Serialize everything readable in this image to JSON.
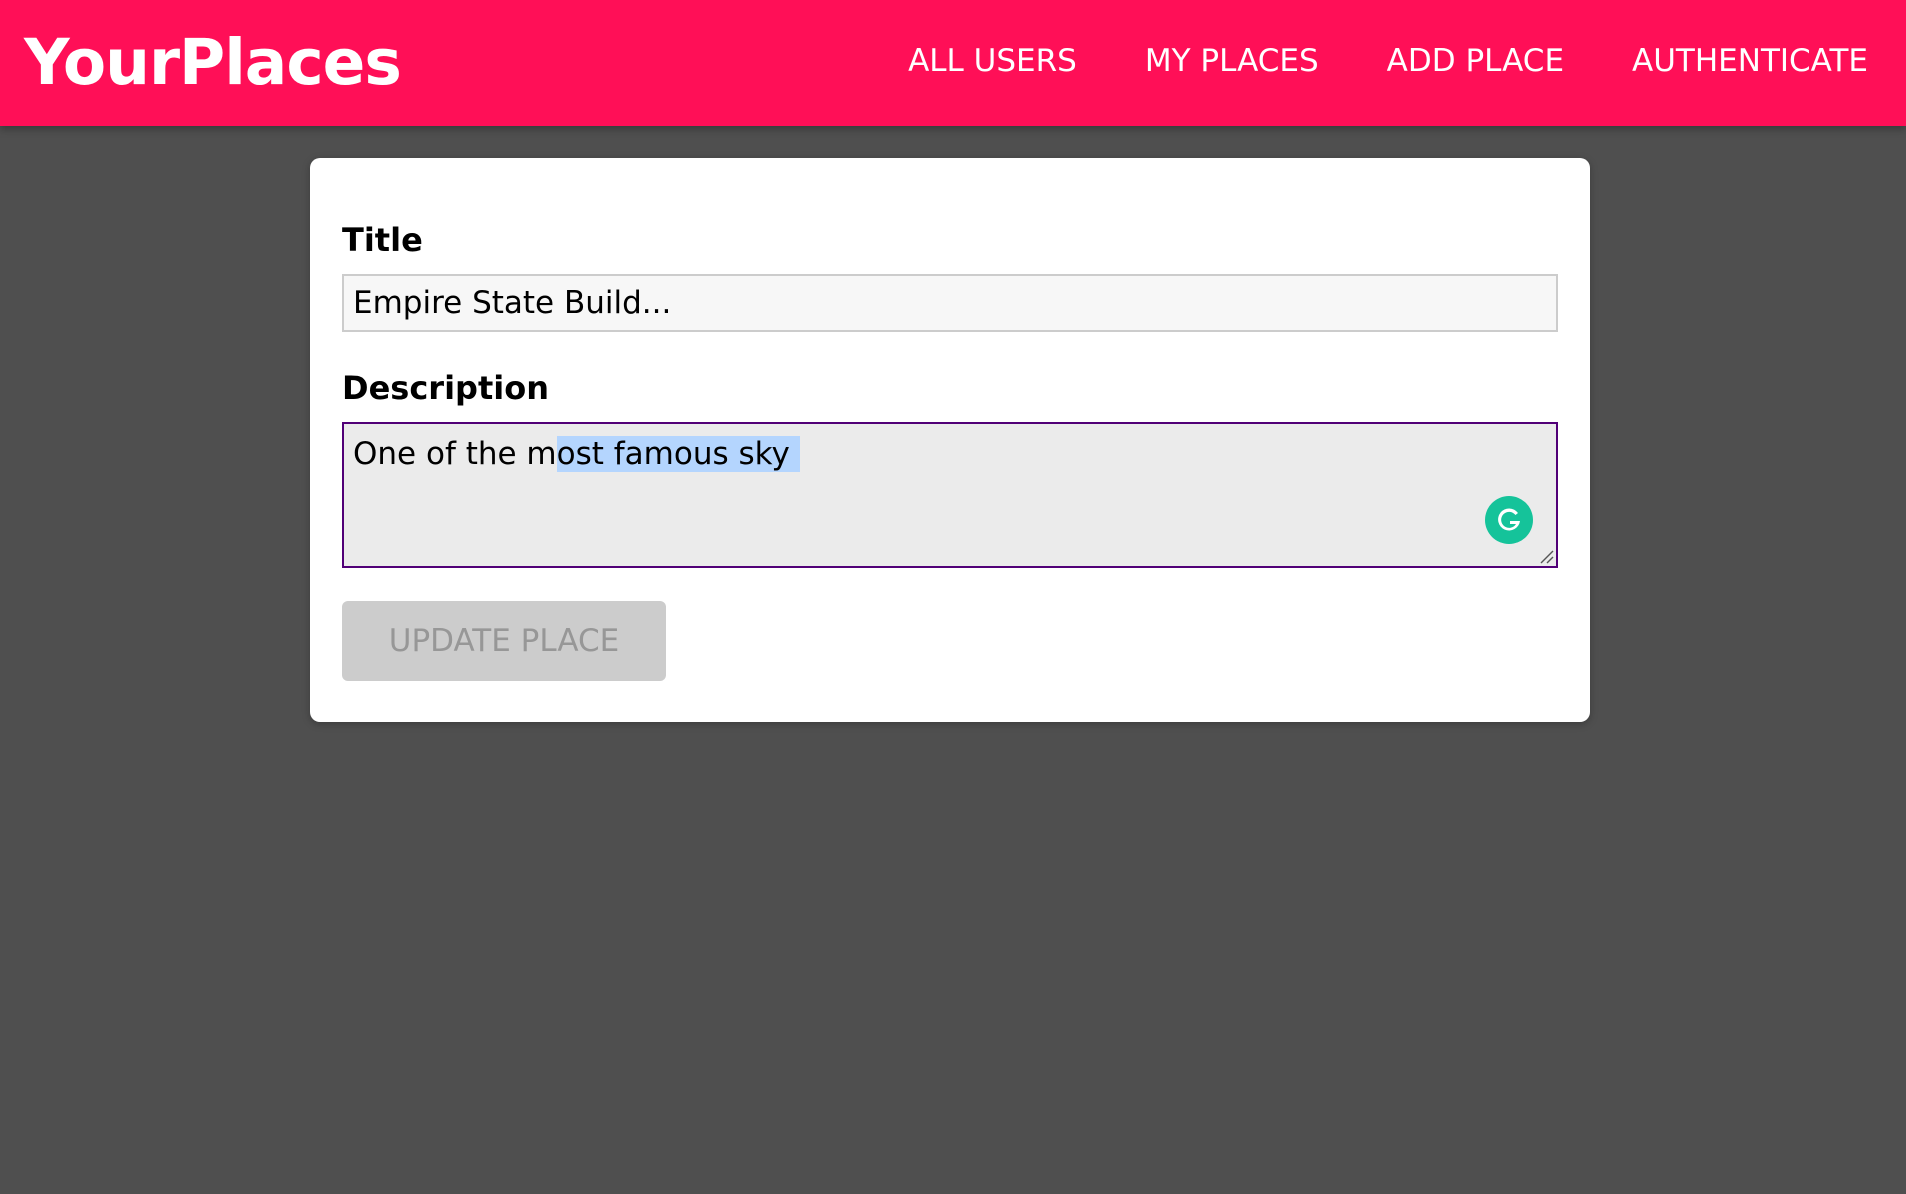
{
  "header": {
    "brand": "YourPlaces",
    "nav": [
      {
        "label": "ALL USERS"
      },
      {
        "label": "MY PLACES"
      },
      {
        "label": "ADD PLACE"
      },
      {
        "label": "AUTHENTICATE"
      }
    ]
  },
  "form": {
    "title_label": "Title",
    "title_value": "Empire State Build...",
    "description_label": "Description",
    "description_value_before_selection": "One of the m",
    "description_value_selected": "ost famous sky ",
    "submit_label": "UPDATE PLACE"
  },
  "icons": {
    "grammarly": "grammarly-icon",
    "resize": "resize-handle-icon"
  },
  "colors": {
    "header_background": "#ff0f57",
    "page_background": "#4f4f4f",
    "grammarly_green": "#15c39a",
    "textarea_focus_border": "#510077",
    "selection_highlight": "#b4d5fe",
    "disabled_button": "#cccccc"
  }
}
